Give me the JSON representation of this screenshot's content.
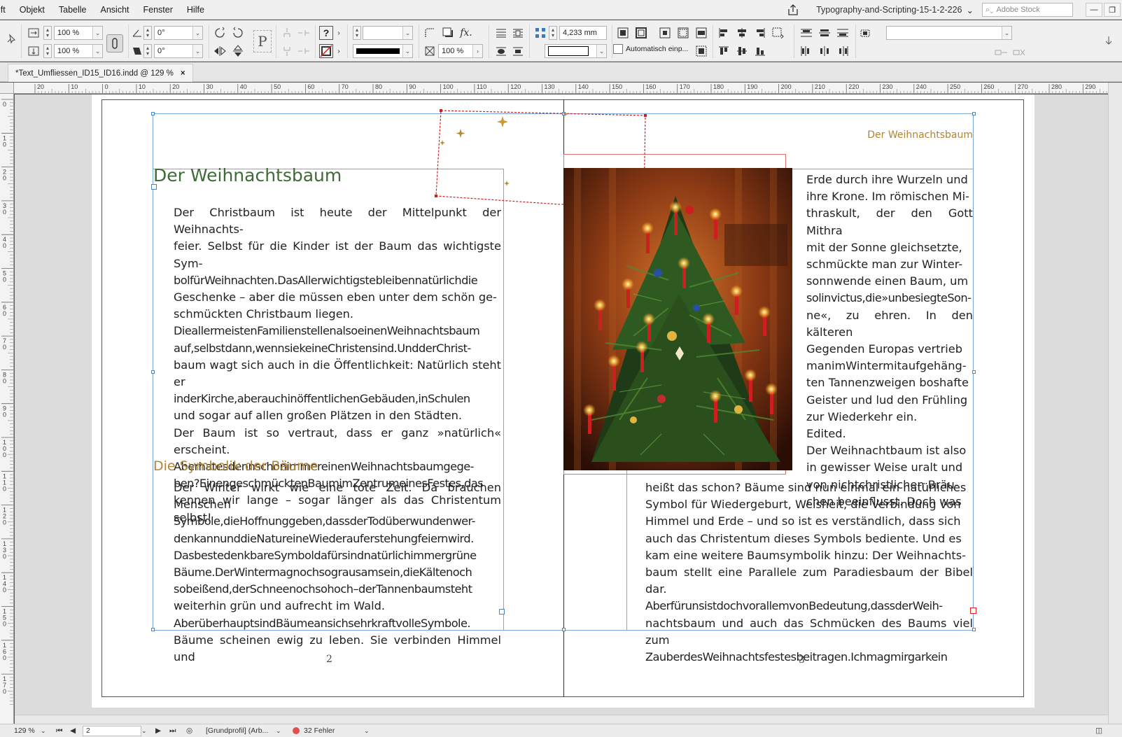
{
  "menu": {
    "partial_first": "ift",
    "items": [
      "Objekt",
      "Tabelle",
      "Ansicht",
      "Fenster",
      "Hilfe"
    ]
  },
  "window": {
    "workspace_title": "Typography-and-Scripting-15-1-2-226",
    "stock_placeholder": "Adobe Stock"
  },
  "control": {
    "scale_x": "100 %",
    "scale_y": "100 %",
    "angle": "0°",
    "shear": "0°",
    "stroke_weight": "",
    "opacity": "100 %",
    "spacing": "4,233 mm",
    "auto_fit_label": "Automatisch einp...",
    "ref_point_note": "fx."
  },
  "tab": {
    "label": "*Text_Umfliessen_ID15_ID16.indd @ 129 %",
    "close": "×"
  },
  "ruler": {
    "h_labels": [
      "20",
      "10",
      "0",
      "10",
      "20",
      "30",
      "40",
      "50",
      "60",
      "70",
      "80",
      "90",
      "100",
      "110",
      "120",
      "130",
      "140",
      "150",
      "160",
      "170",
      "180",
      "190",
      "200",
      "210",
      "220",
      "230",
      "240",
      "250",
      "260",
      "270",
      "280",
      "290"
    ],
    "v_labels": [
      "0",
      "1 0",
      "2 0",
      "3 0",
      "4 0",
      "5 0",
      "6 0",
      "7 0",
      "8 0",
      "9 0",
      "1 0 0",
      "1 1 0",
      "1 2 0",
      "1 3 0",
      "1 4 0",
      "1 5 0",
      "1 6 0",
      "1 7 0"
    ]
  },
  "page": {
    "running_head": "Der Weihnachtsbaum",
    "title": "Der Weihnachtsbaum",
    "subtitle": "Die Symbolik der Bäume",
    "left_col_1": [
      "Der Christbaum ist heute der Mittelpunkt der Weihnachts-",
      "feier. Selbst für die Kinder ist der Baum das wichtigste Sym-",
      "bolfürWeihnachten.DasAllerwichtigstebleibennatürlichdie",
      "Geschenke – aber die müssen eben unter dem schön ge-",
      "schmückten Christbaum liegen.",
      "DieallermeistenFamilienstellenalsoeinenWeihnachtsbaum",
      "auf,selbstdann,wennsiekeineChristensind.UndderChrist-",
      "baum wagt sich auch in die Öffentlichkeit: Natürlich steht er",
      "inderKirche,aberauchinöffentlichenGebäuden,inSchulen",
      "und sogar auf allen großen Plätzen in den Städten.",
      "Der Baum ist so vertraut, dass er ganz »natürlich« erscheint.",
      "AberhatesdennschonimmereinenWeihnachtsbaumgege-",
      "ben?EinengeschmücktenBaumimZentrumeinesFestes,das",
      "kennen wir lange – sogar länger als das Christentum selbst!"
    ],
    "left_col_2": [
      "Der Winter wirkt wie eine tote Zeit. Da brauchen Menschen",
      "Symbole,dieHoffnunggeben,dassderTodüberwundenwer-",
      "denkannunddieNatureineWiederauferstehungfeiernwird.",
      "DasbestedenkbareSymboldafürsindnatürlichimmergrüne",
      "Bäume.DerWintermagnochsograusamsein,dieKältenoch",
      "sobeißend,derSchneenochsohoch–derTannenbaumsteht",
      "weiterhin grün und aufrecht im Wald.",
      "AberüberhauptsindBäumeansichsehrkraftvolleSymbole.",
      "Bäume scheinen ewig zu leben. Sie verbinden Himmel und"
    ],
    "right_col_top": [
      "Erde durch ihre Wurzeln und",
      "ihre Krone. Im römischen Mi-",
      "thraskult, der den Gott Mithra",
      "mit der Sonne gleichsetzte,",
      "schmückte man zur Winter-",
      "sonnwende einen Baum, um",
      "solinvictus,die»unbesiegteSon-",
      "ne«, zu ehren. In den kälteren",
      "Gegenden Europas vertrieb",
      "manimWintermitaufgehäng-",
      "ten Tannenzweigen boshafte",
      "Geister und lud den Frühling",
      "zur Wiederkehr ein.",
      "Edited.",
      "Der Weihnachtbaum ist also",
      "in gewisser Weise uralt und",
      "von nichtchristlichen Bräu-",
      "chen beeinflusst. Doch was"
    ],
    "right_col_bottom": [
      "heißt das schon? Bäume sind nun einmal ein natürliches",
      "Symbol für Wiedergeburt, Weisheit, die Verbindung von",
      "Himmel und Erde – und so ist es verständlich, dass sich",
      "auch das Christentum dieses Symbols bediente. Und es",
      "kam eine weitere Baumsymbolik hinzu: Der Weihnachts-",
      "baum stellt eine Parallele zum Paradiesbaum der Bibel dar.",
      "AberfürunsistdochvorallemvonBedeutung,dassderWeih-",
      "nachtsbaum und auch das Schmücken des Baums viel zum",
      "ZauberdesWeihnachtsfestesbeitragen.Ichmagmirgarkein"
    ],
    "page_left": "2",
    "page_right": "3"
  },
  "status": {
    "zoom": "129 %",
    "page": "2",
    "profile": "[Grundprofil] (Arb...",
    "errors": "32 Fehler"
  },
  "colors": {
    "heading_green": "#3f6b37",
    "accent_gold": "#b08436",
    "frame_blue": "#7aa8d8",
    "error_red": "#e05050"
  }
}
